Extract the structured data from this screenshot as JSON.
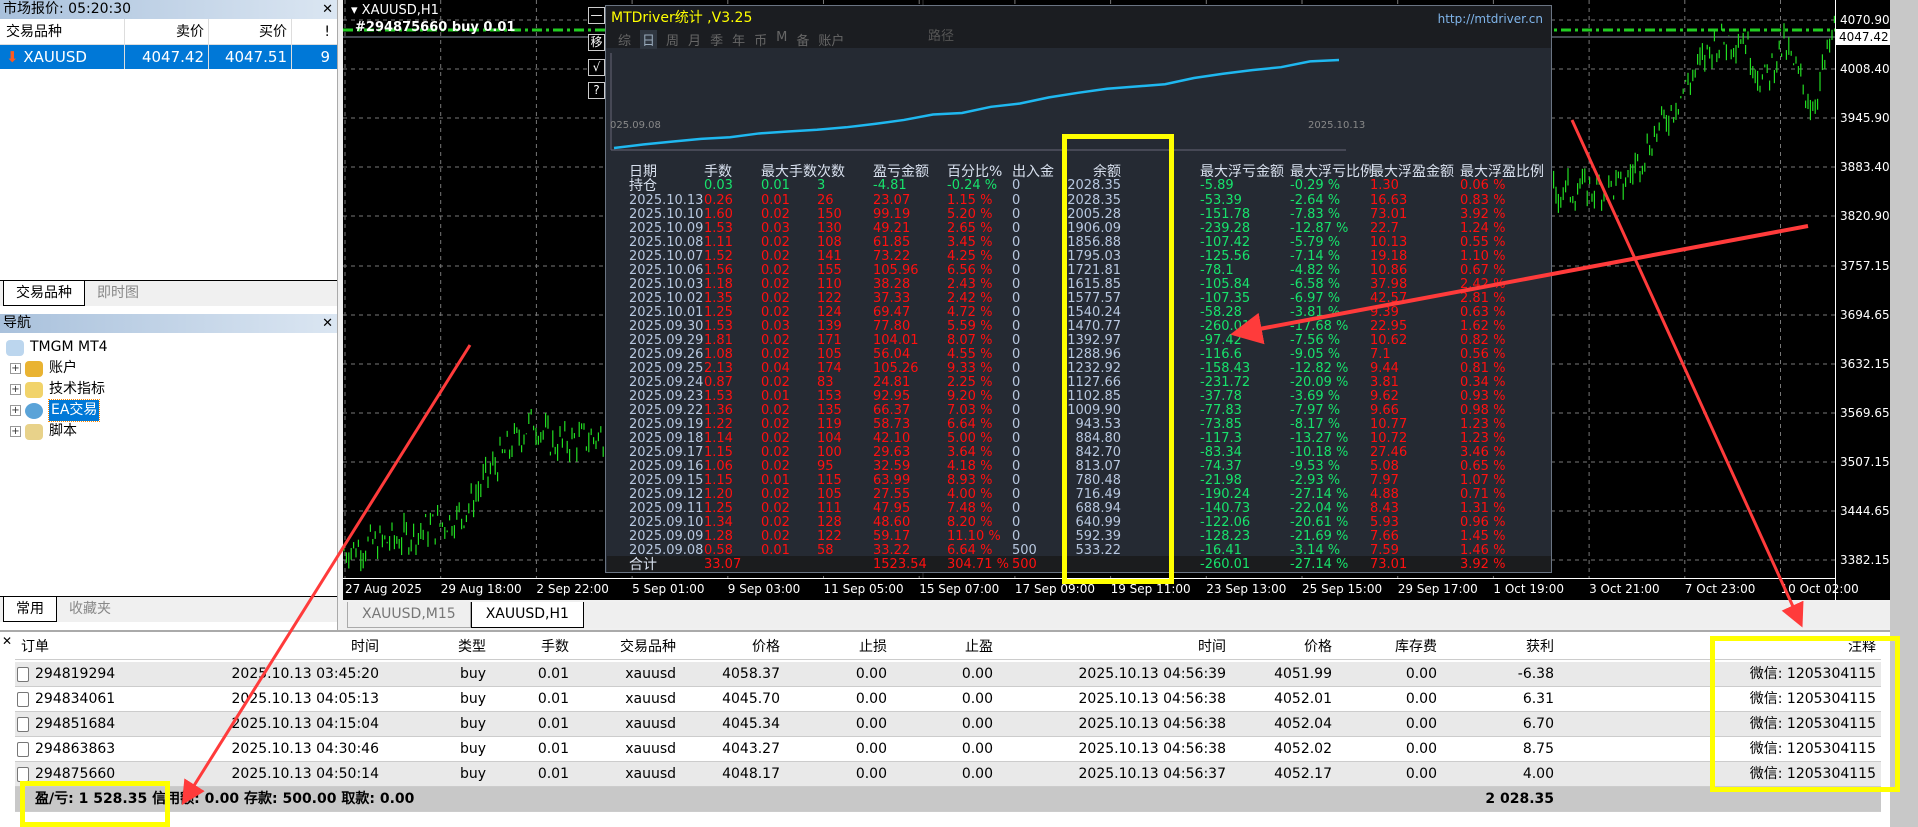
{
  "market_watch": {
    "title": "市场报价: 05:20:30",
    "headers": [
      "交易品种",
      "卖价",
      "买价",
      "!"
    ],
    "rows": [
      {
        "symbol": "XAUUSD",
        "bid": "4047.42",
        "ask": "4047.51",
        "spread": "9"
      }
    ],
    "tabs": [
      "交易品种",
      "即时图"
    ]
  },
  "navigator": {
    "title": "导航",
    "root": "TMGM MT4",
    "items": [
      "账户",
      "技术指标",
      "EA交易",
      "脚本"
    ],
    "tabs": [
      "常用",
      "收藏夹"
    ]
  },
  "chart": {
    "title": "XAUUSD,H1",
    "order_label": "#294875660 buy 0.01",
    "current_price": "4047.42",
    "price_ticks": [
      "4070.90",
      "4008.40",
      "3945.90",
      "3883.40",
      "3820.90",
      "3757.15",
      "3694.65",
      "3632.15",
      "3569.65",
      "3507.15",
      "3444.65",
      "3382.15"
    ],
    "time_ticks": [
      "27 Aug 2025",
      "29 Aug 18:00",
      "2 Sep 22:00",
      "5 Sep 01:00",
      "9 Sep 03:00",
      "11 Sep 05:00",
      "15 Sep 07:00",
      "17 Sep 09:00",
      "19 Sep 11:00",
      "23 Sep 13:00",
      "25 Sep 15:00",
      "29 Sep 17:00",
      "1 Oct 19:00",
      "3 Oct 21:00",
      "7 Oct 23:00",
      "10 Oct 02:00"
    ],
    "tabs": [
      "XAUUSD,M15",
      "XAUUSD,H1"
    ]
  },
  "stats": {
    "title": "MTDriver统计 ,V3.25",
    "url": "http://mtdriver.cn",
    "path_label": "路径",
    "side_buttons": [
      "—",
      "移",
      "√",
      "?"
    ],
    "tabs": [
      "综",
      "日",
      "周",
      "月",
      "季",
      "年",
      "币",
      "M",
      "备",
      "账户"
    ],
    "graph_start": "025.09.08",
    "graph_end": "2025.10.13",
    "headers": [
      "日期",
      "手数",
      "最大手数",
      "次数",
      "盈亏金额",
      "百分比%",
      "出入金",
      "余额",
      "最大浮亏金额",
      "最大浮亏比例",
      "最大浮盈金额",
      "最大浮盈比例"
    ],
    "holding": {
      "label": "持仓",
      "lots": "0.03",
      "max_lots": "0.01",
      "count": "3",
      "pnl": "-4.81",
      "pct": "-0.24 %",
      "deposit": "0",
      "balance": "2028.35",
      "max_dd": "-5.89",
      "max_dd_pct": "-0.29 %",
      "max_fp": "1.30",
      "max_fp_pct": "0.06 %"
    },
    "rows": [
      [
        "2025.10.13",
        "0.26",
        "0.01",
        "26",
        "23.07",
        "1.15 %",
        "0",
        "2028.35",
        "-53.39",
        "-2.64 %",
        "16.63",
        "0.83 %"
      ],
      [
        "2025.10.10",
        "1.60",
        "0.02",
        "150",
        "99.19",
        "5.20 %",
        "0",
        "2005.28",
        "-151.78",
        "-7.83 %",
        "73.01",
        "3.92 %"
      ],
      [
        "2025.10.09",
        "1.53",
        "0.03",
        "130",
        "49.21",
        "2.65 %",
        "0",
        "1906.09",
        "-239.28",
        "-12.87 %",
        "22.7",
        "1.24 %"
      ],
      [
        "2025.10.08",
        "1.11",
        "0.02",
        "108",
        "61.85",
        "3.45 %",
        "0",
        "1856.88",
        "-107.42",
        "-5.79 %",
        "10.13",
        "0.55 %"
      ],
      [
        "2025.10.07",
        "1.52",
        "0.02",
        "141",
        "73.22",
        "4.25 %",
        "0",
        "1795.03",
        "-125.56",
        "-7.14 %",
        "19.18",
        "1.10 %"
      ],
      [
        "2025.10.06",
        "1.56",
        "0.02",
        "155",
        "105.96",
        "6.56 %",
        "0",
        "1721.81",
        "-78.1",
        "-4.82 %",
        "10.86",
        "0.67 %"
      ],
      [
        "2025.10.03",
        "1.18",
        "0.02",
        "110",
        "38.28",
        "2.43 %",
        "0",
        "1615.85",
        "-105.84",
        "-6.58 %",
        "37.98",
        "2.42 %"
      ],
      [
        "2025.10.02",
        "1.35",
        "0.02",
        "122",
        "37.33",
        "2.42 %",
        "0",
        "1577.57",
        "-107.35",
        "-6.97 %",
        "42.57",
        "2.81 %"
      ],
      [
        "2025.10.01",
        "1.25",
        "0.02",
        "124",
        "69.47",
        "4.72 %",
        "0",
        "1540.24",
        "-58.28",
        "-3.81 %",
        "9.39",
        "0.63 %"
      ],
      [
        "2025.09.30",
        "1.53",
        "0.03",
        "139",
        "77.80",
        "5.59 %",
        "0",
        "1470.77",
        "-260.01",
        "-17.68 %",
        "22.95",
        "1.62 %"
      ],
      [
        "2025.09.29",
        "1.81",
        "0.02",
        "171",
        "104.01",
        "8.07 %",
        "0",
        "1392.97",
        "-97.42",
        "-7.56 %",
        "10.62",
        "0.82 %"
      ],
      [
        "2025.09.26",
        "1.08",
        "0.02",
        "105",
        "56.04",
        "4.55 %",
        "0",
        "1288.96",
        "-116.6",
        "-9.05 %",
        "7.1",
        "0.56 %"
      ],
      [
        "2025.09.25",
        "2.13",
        "0.04",
        "174",
        "105.26",
        "9.33 %",
        "0",
        "1232.92",
        "-158.43",
        "-12.82 %",
        "9.44",
        "0.81 %"
      ],
      [
        "2025.09.24",
        "0.87",
        "0.02",
        "83",
        "24.81",
        "2.25 %",
        "0",
        "1127.66",
        "-231.72",
        "-20.09 %",
        "3.81",
        "0.34 %"
      ],
      [
        "2025.09.23",
        "1.53",
        "0.01",
        "153",
        "92.95",
        "9.20 %",
        "0",
        "1102.85",
        "-37.78",
        "-3.69 %",
        "9.62",
        "0.93 %"
      ],
      [
        "2025.09.22",
        "1.36",
        "0.02",
        "135",
        "66.37",
        "7.03 %",
        "0",
        "1009.90",
        "-77.83",
        "-7.97 %",
        "9.66",
        "0.98 %"
      ],
      [
        "2025.09.19",
        "1.22",
        "0.02",
        "119",
        "58.73",
        "6.64 %",
        "0",
        "943.53",
        "-73.85",
        "-8.17 %",
        "10.77",
        "1.23 %"
      ],
      [
        "2025.09.18",
        "1.14",
        "0.02",
        "104",
        "42.10",
        "5.00 %",
        "0",
        "884.80",
        "-117.3",
        "-13.27 %",
        "10.72",
        "1.23 %"
      ],
      [
        "2025.09.17",
        "1.15",
        "0.02",
        "100",
        "29.63",
        "3.64 %",
        "0",
        "842.70",
        "-83.34",
        "-10.18 %",
        "27.46",
        "3.46 %"
      ],
      [
        "2025.09.16",
        "1.06",
        "0.02",
        "95",
        "32.59",
        "4.18 %",
        "0",
        "813.07",
        "-74.37",
        "-9.53 %",
        "5.08",
        "0.65 %"
      ],
      [
        "2025.09.15",
        "1.15",
        "0.01",
        "115",
        "63.99",
        "8.93 %",
        "0",
        "780.48",
        "-21.98",
        "-2.93 %",
        "7.97",
        "1.07 %"
      ],
      [
        "2025.09.12",
        "1.20",
        "0.02",
        "105",
        "27.55",
        "4.00 %",
        "0",
        "716.49",
        "-190.24",
        "-27.14 %",
        "4.88",
        "0.71 %"
      ],
      [
        "2025.09.11",
        "1.25",
        "0.02",
        "111",
        "47.95",
        "7.48 %",
        "0",
        "688.94",
        "-140.73",
        "-22.04 %",
        "8.43",
        "1.31 %"
      ],
      [
        "2025.09.10",
        "1.34",
        "0.02",
        "128",
        "48.60",
        "8.20 %",
        "0",
        "640.99",
        "-122.06",
        "-20.61 %",
        "5.93",
        "0.96 %"
      ],
      [
        "2025.09.09",
        "1.28",
        "0.02",
        "122",
        "59.17",
        "11.10 %",
        "0",
        "592.39",
        "-128.23",
        "-21.69 %",
        "7.66",
        "1.45 %"
      ],
      [
        "2025.09.08",
        "0.58",
        "0.01",
        "58",
        "33.22",
        "6.64 %",
        "500",
        "533.22",
        "-16.41",
        "-3.14 %",
        "7.59",
        "1.46 %"
      ]
    ],
    "total": {
      "label": "合计",
      "lots": "33.07",
      "pnl": "1523.54",
      "pct": "304.71 %",
      "deposit": "500",
      "max_dd": "-260.01",
      "max_dd_pct": "-27.14 %",
      "max_fp": "73.01",
      "max_fp_pct": "3.92 %"
    }
  },
  "terminal": {
    "headers": [
      "订单",
      "时间",
      "类型",
      "手数",
      "交易品种",
      "价格",
      "止损",
      "止盈",
      "时间",
      "价格",
      "库存费",
      "获利",
      "注释"
    ],
    "rows": [
      [
        "294819294",
        "2025.10.13 03:45:20",
        "buy",
        "0.01",
        "xauusd",
        "4058.37",
        "0.00",
        "0.00",
        "2025.10.13 04:56:39",
        "4051.99",
        "0.00",
        "-6.38",
        "微信: 1205304115"
      ],
      [
        "294834061",
        "2025.10.13 04:05:13",
        "buy",
        "0.01",
        "xauusd",
        "4045.70",
        "0.00",
        "0.00",
        "2025.10.13 04:56:38",
        "4052.01",
        "0.00",
        "6.31",
        "微信: 1205304115"
      ],
      [
        "294851684",
        "2025.10.13 04:15:04",
        "buy",
        "0.01",
        "xauusd",
        "4045.34",
        "0.00",
        "0.00",
        "2025.10.13 04:56:38",
        "4052.04",
        "0.00",
        "6.70",
        "微信: 1205304115"
      ],
      [
        "294863863",
        "2025.10.13 04:30:46",
        "buy",
        "0.01",
        "xauusd",
        "4043.27",
        "0.00",
        "0.00",
        "2025.10.13 04:56:38",
        "4052.02",
        "0.00",
        "8.75",
        "微信: 1205304115"
      ],
      [
        "294875660",
        "2025.10.13 04:50:14",
        "buy",
        "0.01",
        "xauusd",
        "4048.17",
        "0.00",
        "0.00",
        "2025.10.13 04:56:37",
        "4052.17",
        "0.00",
        "4.00",
        "微信: 1205304115"
      ]
    ],
    "summary": "盈/亏: 1 528.35  信用额: 0.00  存款: 500.00  取款: 0.00",
    "total_profit": "2 028.35"
  },
  "colors": {
    "accent": "#0078d7",
    "candle": "#22dd22",
    "loss": "#ff1010",
    "gain": "#17e36c",
    "highlight": "#ffff00",
    "curve": "#1fb8f0"
  }
}
